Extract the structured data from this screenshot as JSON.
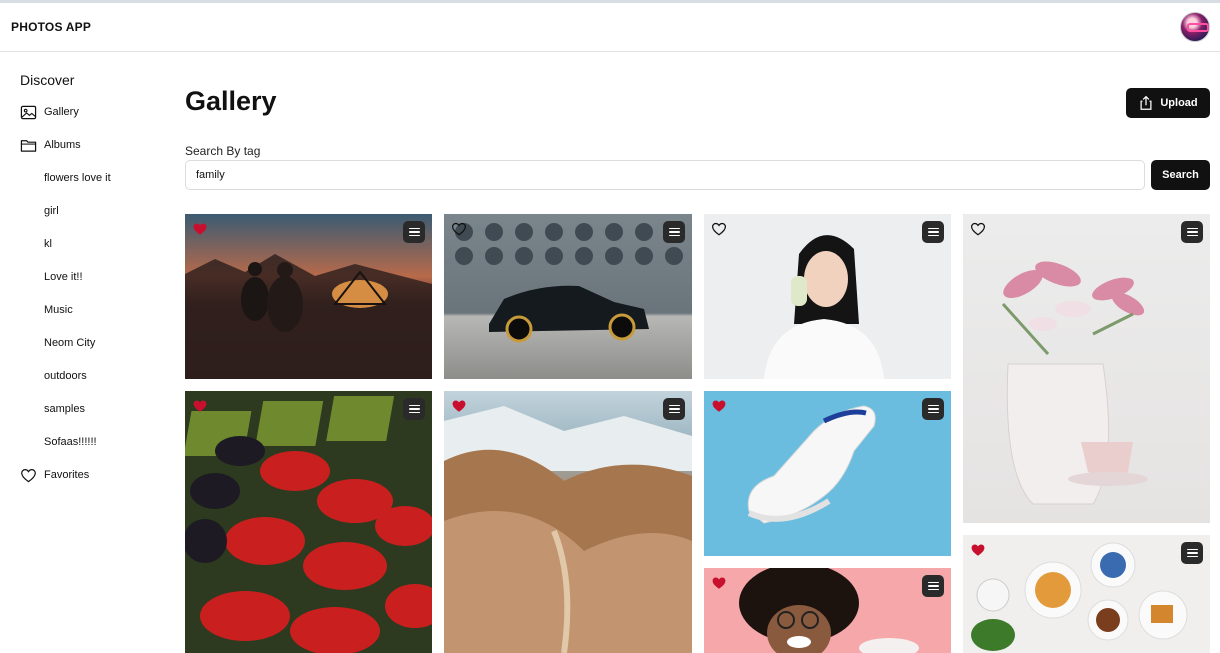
{
  "app": {
    "title": "PHOTOS APP"
  },
  "sidebar": {
    "heading": "Discover",
    "gallery_label": "Gallery",
    "albums_label": "Albums",
    "albums": [
      "flowers love it",
      "girl",
      "kl",
      "Love it!!",
      "Music",
      "Neom City",
      "outdoors",
      "samples",
      "Sofaas!!!!!!"
    ],
    "favorites_label": "Favorites"
  },
  "main": {
    "title": "Gallery",
    "upload_label": "Upload",
    "search_label": "Search By tag",
    "search_value": "family",
    "search_button": "Search"
  },
  "photos": [
    {
      "subject": "desert campfire at dusk",
      "favorited": true
    },
    {
      "subject": "black suv in front of building",
      "favorited": false
    },
    {
      "subject": "girl with ice cream",
      "favorited": false
    },
    {
      "subject": "pink lilies in vase with coffee cup",
      "favorited": false
    },
    {
      "subject": "berries at market",
      "favorited": true
    },
    {
      "subject": "mountain valley landscape",
      "favorited": true
    },
    {
      "subject": "white sneaker on blue",
      "favorited": true
    },
    {
      "subject": "smiling woman on pink",
      "favorited": true
    },
    {
      "subject": "breakfast table",
      "favorited": true
    }
  ],
  "colors": {
    "accent": "#111111",
    "heart_filled": "#c8102e",
    "border": "#dcdcdc"
  }
}
